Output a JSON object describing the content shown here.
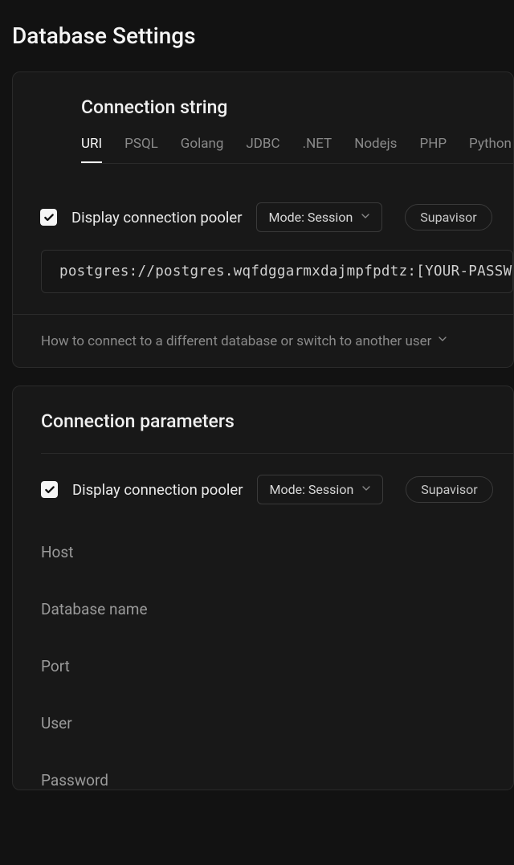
{
  "pageTitle": "Database Settings",
  "connectionString": {
    "title": "Connection string",
    "tabs": [
      "URI",
      "PSQL",
      "Golang",
      "JDBC",
      ".NET",
      "Nodejs",
      "PHP",
      "Python"
    ],
    "activeTab": "URI",
    "poolerCheckboxLabel": "Display connection pooler",
    "poolerChecked": true,
    "modeLabel": "Mode: Session",
    "providerButtonLabel": "Supavisor",
    "connectionUri": "postgres://postgres.wqfdggarmxdajmpfpdtz:[YOUR-PASSWORD]",
    "expandRowLabel": "How to connect to a different database or switch to another user"
  },
  "connectionParameters": {
    "title": "Connection parameters",
    "poolerCheckboxLabel": "Display connection pooler",
    "poolerChecked": true,
    "modeLabel": "Mode: Session",
    "providerButtonLabel": "Supavisor",
    "fields": {
      "host": "Host",
      "databaseName": "Database name",
      "port": "Port",
      "user": "User",
      "password": "Password"
    }
  }
}
